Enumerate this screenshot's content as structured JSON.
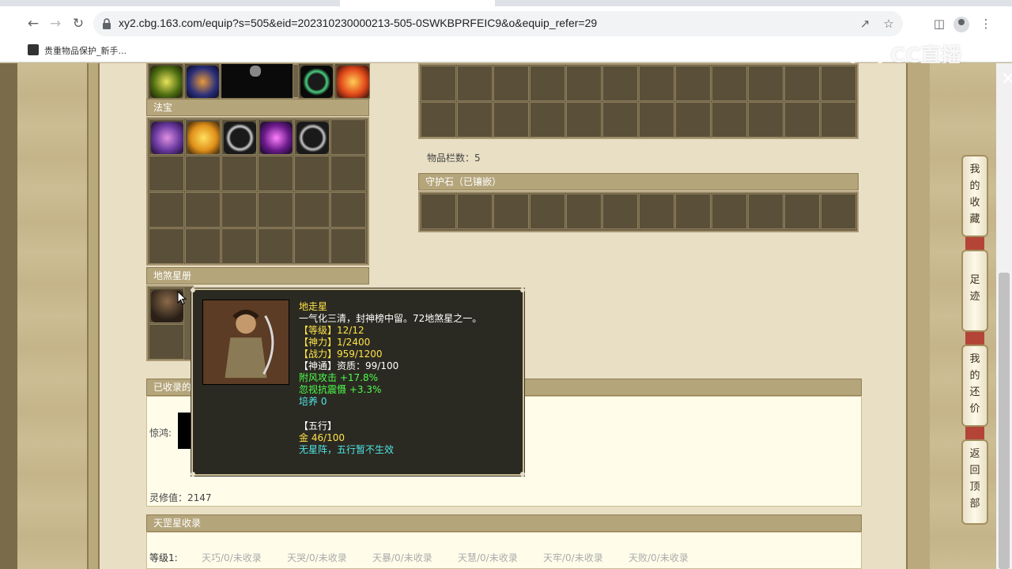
{
  "browser": {
    "url": "xy2.cbg.163.com/equip?s=505&eid=202310230000213-505-0SWKBPRFEIC9&o&equip_refer=29",
    "bookmark_label": "贵重物品保护_新手..."
  },
  "watermark": "CC直播",
  "sections": {
    "fabao_header": "法宝",
    "disha_header": "地煞星册",
    "item_count_label": "物品栏数：5",
    "guardian_stone_header": "守护石（已镶嵌）",
    "collected_header": "已收录的",
    "jinghong_label": "惊鸿:",
    "spirit_value_label": "灵修值：2147",
    "tiangang_header": "天罡星收录",
    "level_label": "等级1:",
    "tiangang_items": [
      "天巧/0/未收录",
      "天哭/0/未收录",
      "天暴/0/未收录",
      "天慧/0/未收录",
      "天牢/0/未收录",
      "天败/0/未收录"
    ]
  },
  "side_buttons": [
    "我的收藏",
    "足迹",
    "我的还价",
    "返回顶部"
  ],
  "tooltip": {
    "name": "地走星",
    "desc": "一气化三清，封神榜中留。72地煞星之一。",
    "level": "【等级】12/12",
    "shenli": "【神力】1/2400",
    "zhanli": "【战力】959/1200",
    "shentong": "【神通】资质：99/100",
    "bonus1": "附风攻击 +17.8%",
    "bonus2": "忽视抗震慑 +3.3%",
    "cultivate": "培养 0",
    "wuxing_title": "【五行】",
    "metal": "金 46/100",
    "no_array": "无星阵，五行暂不生效"
  },
  "colors": {
    "panel_header": "#b5a57b",
    "tooltip_bg": "#2b2a22",
    "yellow_text": "#ffe34a",
    "green_text": "#4cff4c",
    "cyan_text": "#4fe6e6"
  }
}
